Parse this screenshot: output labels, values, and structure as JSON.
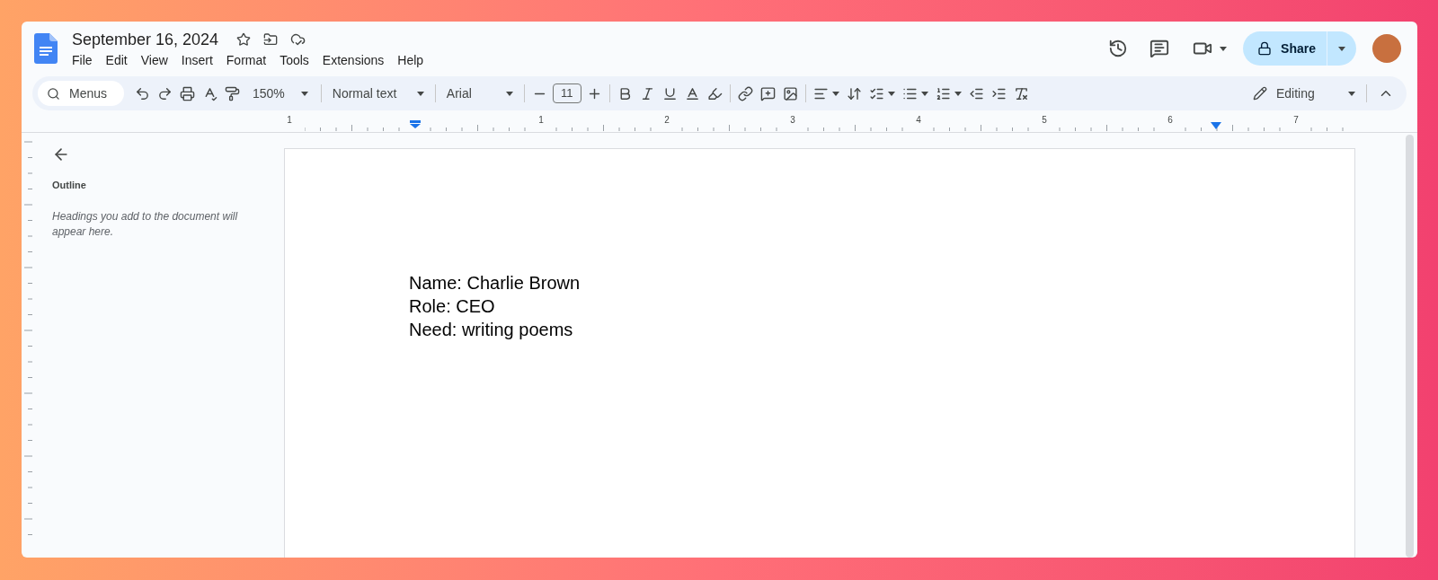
{
  "document": {
    "title": "September 16, 2024"
  },
  "menu": [
    "File",
    "Edit",
    "View",
    "Insert",
    "Format",
    "Tools",
    "Extensions",
    "Help"
  ],
  "share": {
    "label": "Share"
  },
  "toolbar": {
    "search_placeholder": "Menus",
    "zoom": "150%",
    "style": "Normal text",
    "font": "Arial",
    "font_size": "11",
    "mode": "Editing"
  },
  "ruler": {
    "labels": [
      "1",
      "1",
      "2",
      "3",
      "4",
      "5",
      "6",
      "7"
    ]
  },
  "sidebar": {
    "heading": "Outline",
    "hint": "Headings you add to the document will appear here."
  },
  "page": {
    "lines": [
      "Name: Charlie Brown",
      "Role: CEO",
      "Need: writing poems"
    ]
  }
}
